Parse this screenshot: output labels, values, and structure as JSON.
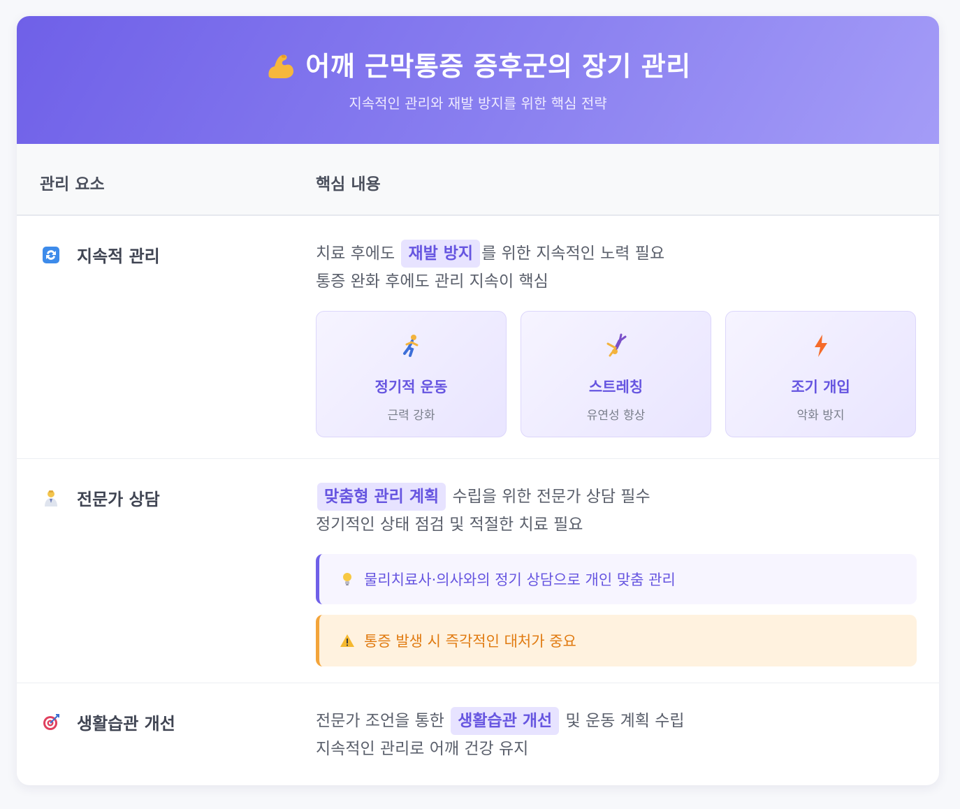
{
  "header": {
    "title": "어깨 근막통증 증후군의 장기 관리",
    "subtitle": "지속적인 관리와 재발 방지를 위한 핵심 전략"
  },
  "table": {
    "col_element": "관리 요소",
    "col_content": "핵심 내용"
  },
  "rows": [
    {
      "label": "지속적 관리",
      "icon": "repeat-icon",
      "line1_before": "치료 후에도 ",
      "line1_highlight": "재발 방지",
      "line1_after": "를 위한 지속적인 노력 필요",
      "line2": "통증 완화 후에도 관리 지속이 핵심",
      "boxes": [
        {
          "icon": "running-person-icon",
          "title": "정기적 운동",
          "desc": "근력 강화"
        },
        {
          "icon": "cartwheel-person-icon",
          "title": "스트레칭",
          "desc": "유연성 향상"
        },
        {
          "icon": "lightning-icon",
          "title": "조기 개입",
          "desc": "악화 방지"
        }
      ]
    },
    {
      "label": "전문가 상담",
      "icon": "health-worker-icon",
      "line1_highlight": "맞춤형 관리 계획",
      "line1_after": " 수립을 위한 전문가 상담 필수",
      "line2": "정기적인 상태 점검 및 적절한 치료 필요",
      "tip": "물리치료사·의사와의 정기 상담으로 개인 맞춤 관리",
      "warning": "통증 발생 시 즉각적인 대처가 중요"
    },
    {
      "label": "생활습관 개선",
      "icon": "target-icon",
      "line1_before": "전문가 조언을 통한 ",
      "line1_highlight": "생활습관 개선",
      "line1_after": " 및 운동 계획 수립",
      "line2": "지속적인 관리로 어깨 건강 유지"
    }
  ],
  "colors": {
    "accent": "#6f60e8",
    "highlight_bg": "#e7e3ff",
    "warning": "#f3a43a"
  }
}
